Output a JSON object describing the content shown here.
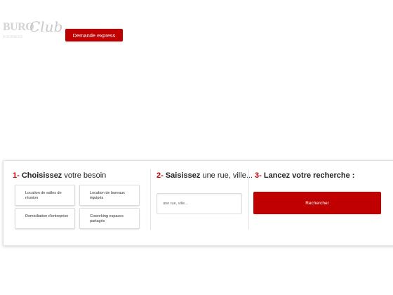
{
  "header": {
    "logo": {
      "main": "BURO",
      "sub": "BUSINESS",
      "script": "Club"
    },
    "express_button": "Demande express"
  },
  "search": {
    "step1": {
      "num": "1-",
      "strong": "Choisissez",
      "rest": " votre besoin"
    },
    "step2": {
      "num": "2-",
      "strong": "Saisissez",
      "rest": " une rue, ville..."
    },
    "step3": {
      "num": "3-",
      "strong": "Lancez votre recherche :"
    },
    "options": [
      {
        "label": "Location de salles de réunion"
      },
      {
        "label": "Location de bureaux équipés"
      },
      {
        "label": "Domiciliation d'entreprise"
      },
      {
        "label": "Coworking espaces partagés"
      }
    ],
    "input_placeholder": "une rue, ville...",
    "search_button": "Rechercher"
  },
  "colors": {
    "accent": "#c00000",
    "logo": "#cfcfcf"
  }
}
